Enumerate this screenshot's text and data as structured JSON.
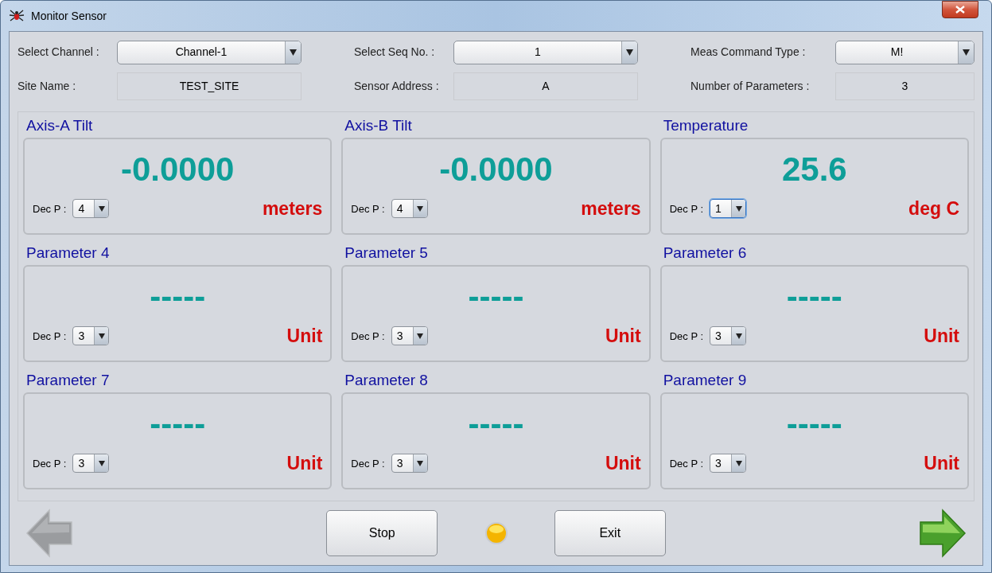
{
  "window": {
    "title": "Monitor Sensor"
  },
  "header": [
    {
      "label": "Select Channel :",
      "kind": "combo",
      "value": "Channel-1"
    },
    {
      "label": "Select Seq No. :",
      "kind": "combo",
      "value": "1"
    },
    {
      "label": "Meas Command Type :",
      "kind": "combo",
      "value": "M!"
    },
    {
      "label": "Site Name :",
      "kind": "readout",
      "value": "TEST_SITE"
    },
    {
      "label": "Sensor Address :",
      "kind": "readout",
      "value": "A"
    },
    {
      "label": "Number of Parameters :",
      "kind": "readout",
      "value": "3"
    }
  ],
  "parameters": [
    {
      "title": "Axis-A Tilt",
      "value": "-0.0000",
      "dec_label": "Dec P :",
      "dec": "4",
      "dec_focused": false,
      "unit": "meters"
    },
    {
      "title": "Axis-B Tilt",
      "value": "-0.0000",
      "dec_label": "Dec P :",
      "dec": "4",
      "dec_focused": false,
      "unit": "meters"
    },
    {
      "title": "Temperature",
      "value": "25.6",
      "dec_label": "Dec P :",
      "dec": "1",
      "dec_focused": true,
      "unit": "deg C"
    },
    {
      "title": "Parameter 4",
      "value": "-----",
      "dec_label": "Dec P :",
      "dec": "3",
      "dec_focused": false,
      "unit": "Unit"
    },
    {
      "title": "Parameter 5",
      "value": "-----",
      "dec_label": "Dec P :",
      "dec": "3",
      "dec_focused": false,
      "unit": "Unit"
    },
    {
      "title": "Parameter 6",
      "value": "-----",
      "dec_label": "Dec P :",
      "dec": "3",
      "dec_focused": false,
      "unit": "Unit"
    },
    {
      "title": "Parameter 7",
      "value": "-----",
      "dec_label": "Dec P :",
      "dec": "3",
      "dec_focused": false,
      "unit": "Unit"
    },
    {
      "title": "Parameter 8",
      "value": "-----",
      "dec_label": "Dec P :",
      "dec": "3",
      "dec_focused": false,
      "unit": "Unit"
    },
    {
      "title": "Parameter 9",
      "value": "-----",
      "dec_label": "Dec P :",
      "dec": "3",
      "dec_focused": false,
      "unit": "Unit"
    }
  ],
  "footer": {
    "back_disabled": true,
    "forward_disabled": false,
    "buttons": [
      "Stop",
      "Exit"
    ]
  }
}
